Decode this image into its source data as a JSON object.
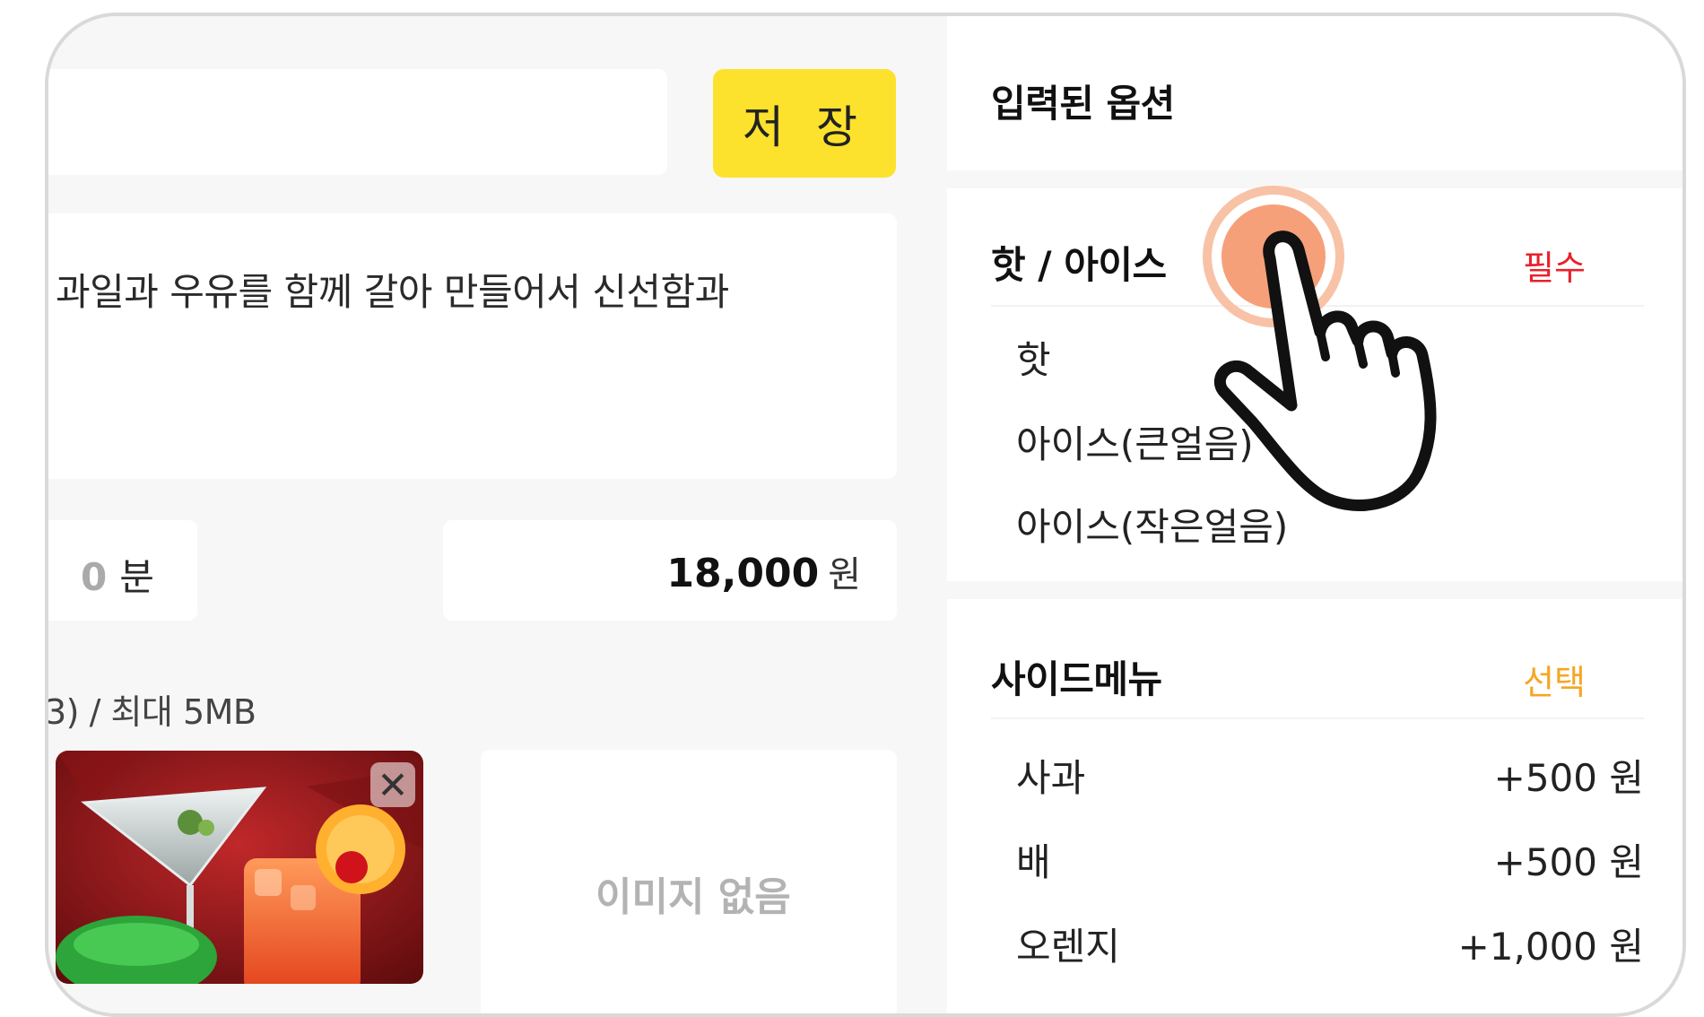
{
  "editor": {
    "save_label": "저 장",
    "description": "과일과 우유를 함께 갈아 만들어서 신선함과",
    "time_value": "0",
    "time_unit": "분",
    "price_value": "18,000",
    "price_unit": "원",
    "image_hint": "3) / 최대 5MB",
    "no_image_label": "이미지 없음",
    "delete_icon": "close-icon"
  },
  "options_panel": {
    "title": "입력된 옵션",
    "groups": [
      {
        "title": "핫 / 아이스",
        "tag": "필수",
        "items": [
          {
            "label": "핫",
            "price": ""
          },
          {
            "label": "아이스(큰얼음)",
            "price": ""
          },
          {
            "label": "아이스(작은얼음)",
            "price": ""
          }
        ]
      },
      {
        "title": "사이드메뉴",
        "tag": "선택",
        "items": [
          {
            "label": "사과",
            "price": "+500 원"
          },
          {
            "label": "배",
            "price": "+500 원"
          },
          {
            "label": "오렌지",
            "price": "+1,000 원"
          }
        ]
      }
    ]
  },
  "colors": {
    "save_button": "#fce22d",
    "required_tag": "#e8212b",
    "optional_tag": "#f5a623",
    "tap_indicator": "#f6a07a"
  },
  "overlay": {
    "icon": "pointing-hand-icon",
    "tap_icon": "tap-indicator-icon"
  }
}
